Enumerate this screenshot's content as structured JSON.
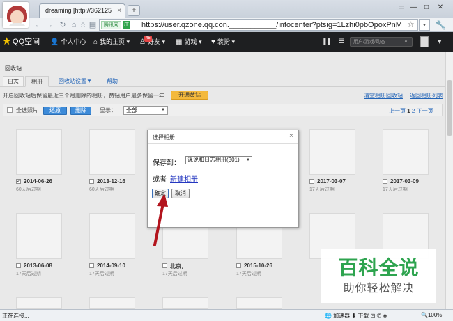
{
  "browser": {
    "tab_title": "dreaming [http://362125",
    "tab_close": "×",
    "new_tab": "+",
    "win_controls": [
      "▭",
      "—",
      "□",
      "✕"
    ],
    "nav_icons": [
      "←",
      "→",
      "↻",
      "⌂",
      "☆",
      "▤"
    ],
    "site_badge": "腾讯网",
    "site_icon": "庄",
    "url": "https://user.qzone.qq.con.___________/infocenter?ptsig=1Lzhi0pbOpoxPnM",
    "url_star": "☆",
    "url_dropdown": "▼",
    "tools_icon": "🔧"
  },
  "qzone_nav": {
    "logo": "QQ空间",
    "items": [
      {
        "icon": "👤",
        "label": "个人中心"
      },
      {
        "icon": "⌂",
        "label": "我的主页 ▾"
      },
      {
        "icon": "♙",
        "label": "好友 ▾"
      },
      {
        "icon": "▦",
        "label": "游戏 ▾"
      },
      {
        "icon": "♥",
        "label": "装扮 ▾"
      }
    ],
    "friend_badge": "45",
    "search_placeholder": "用户/游戏/动态"
  },
  "page": {
    "title": "回收站",
    "tabs": [
      "日志",
      "相册",
      "回收站设置▼",
      "帮助"
    ],
    "notice": "开启回收站后保留最近三个月删除的相册，黄钻用户最多保留一年",
    "vip_button": "开通黄钻",
    "clear_link": "清空相册回收站",
    "back_link": "返回相册列表"
  },
  "toolbar": {
    "select_all": "全选照片",
    "restore": "还原",
    "delete": "删除",
    "display_label": "显示：",
    "display_value": "全部",
    "pager": {
      "prev": "上一页",
      "p1": "1",
      "p2": "2",
      "next": "下一页"
    }
  },
  "photos": [
    {
      "date": "2014-06-26",
      "expire": "60天后过期",
      "checked": true
    },
    {
      "date": "2013-12-16",
      "expire": "60天后过期",
      "checked": false
    },
    {
      "date": "2017-03-07",
      "expire": "17天后过期",
      "checked": false
    },
    {
      "date": "2017-03-09",
      "expire": "17天后过期",
      "checked": false
    },
    {
      "date": "2013-06-08",
      "expire": "17天后过期",
      "checked": false
    },
    {
      "date": "2014-09-10",
      "expire": "17天后过期",
      "checked": false
    },
    {
      "date": "北京，",
      "expire": "17天后过期",
      "checked": false
    },
    {
      "date": "2015-10-26",
      "expire": "17天后过期",
      "checked": false
    }
  ],
  "dialog": {
    "title": "选择相册",
    "close": "×",
    "save_label": "保存到：",
    "album_value": "说说和日志相册(301)",
    "or_label": "或者",
    "new_album_link": "新建相册",
    "confirm": "确定",
    "cancel": "取消"
  },
  "watermark": {
    "main": "百科全说",
    "sub": "助你轻松解决"
  },
  "status": {
    "text": "正在连接...",
    "right": "🌐 加速器  ⬇ 下载  ⊡  ✆  ◈",
    "zoom": "🔍100%"
  },
  "colors": {
    "accent": "#2264b7",
    "vip": "#f4b93c",
    "arrow": "#b3141d",
    "watermark": "#2ea44f"
  }
}
